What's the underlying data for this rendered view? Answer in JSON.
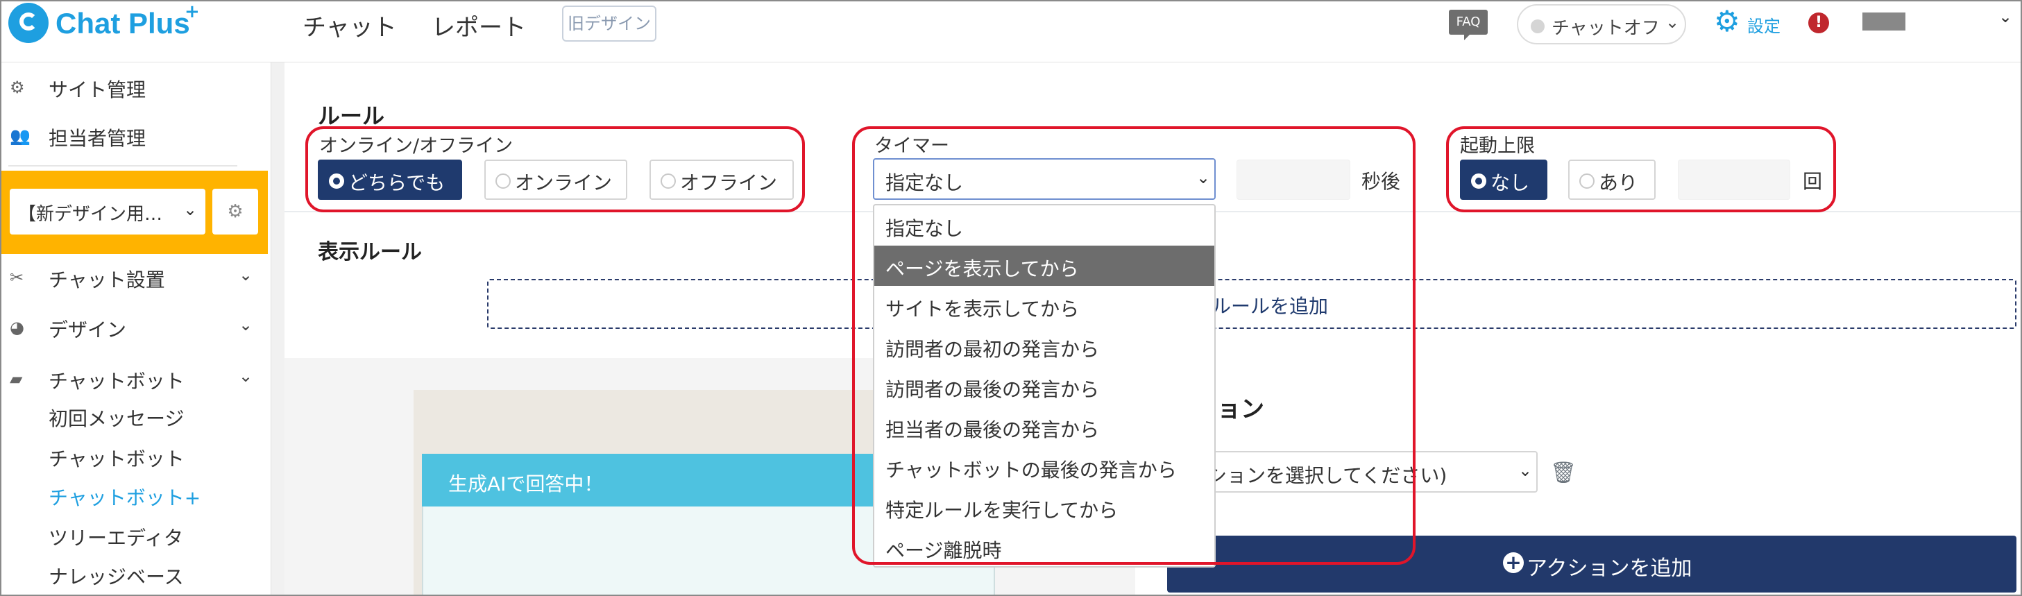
{
  "header": {
    "logo_text": "Chat Plus",
    "logo_sup": "+",
    "nav": [
      "チャット",
      "レポート"
    ],
    "old_design": "旧デザイン",
    "faq": "FAQ",
    "chat_status": "チャットオフ",
    "settings": "設定",
    "alert": "!"
  },
  "sidebar": {
    "items": [
      {
        "label": "サイト管理",
        "icon": "gear-icon"
      },
      {
        "label": "担当者管理",
        "icon": "users-icon"
      }
    ],
    "site_select": "【新デザイン用…",
    "sections": [
      {
        "label": "チャット設置",
        "icon": "tools-icon"
      },
      {
        "label": "デザイン",
        "icon": "palette-icon"
      },
      {
        "label": "チャットボット",
        "icon": "chat-icon"
      }
    ],
    "sub_items": [
      "初回メッセージ",
      "チャットボット",
      "チャットボット+",
      "ツリーエディタ",
      "ナレッジベース"
    ],
    "active_sub": "チャットボット+"
  },
  "rule": {
    "title": "ルール",
    "online_group": {
      "label": "オンライン/オフライン",
      "options": [
        "どちらでも",
        "オンライン",
        "オフライン"
      ],
      "selected": "どちらでも"
    },
    "timer_group": {
      "label": "タイマー",
      "selected": "指定なし",
      "seconds_unit": "秒後",
      "options": [
        "指定なし",
        "ページを表示してから",
        "サイトを表示してから",
        "訪問者の最初の発言から",
        "訪問者の最後の発言から",
        "担当者の最後の発言から",
        "チャットボットの最後の発言から",
        "特定ルールを実行してから",
        "ページ離脱時"
      ],
      "highlighted": "ページを表示してから"
    },
    "limit_group": {
      "label": "起動上限",
      "options": [
        "なし",
        "あり"
      ],
      "selected": "なし",
      "unit": "回"
    }
  },
  "display_rule": {
    "title": "表示ルール",
    "add_label": "ルールを追加"
  },
  "preview": {
    "header": "生成AIで回答中！"
  },
  "action": {
    "title": "ション",
    "select_placeholder": "クションを選択してください)",
    "add_label": "アクションを追加"
  },
  "colors": {
    "brand": "#1e9fe0",
    "navy": "#1f3a6e",
    "highlight_red": "#e0152a",
    "sidebar_accent": "#ffb300",
    "chat_header": "#4ec2e0"
  }
}
